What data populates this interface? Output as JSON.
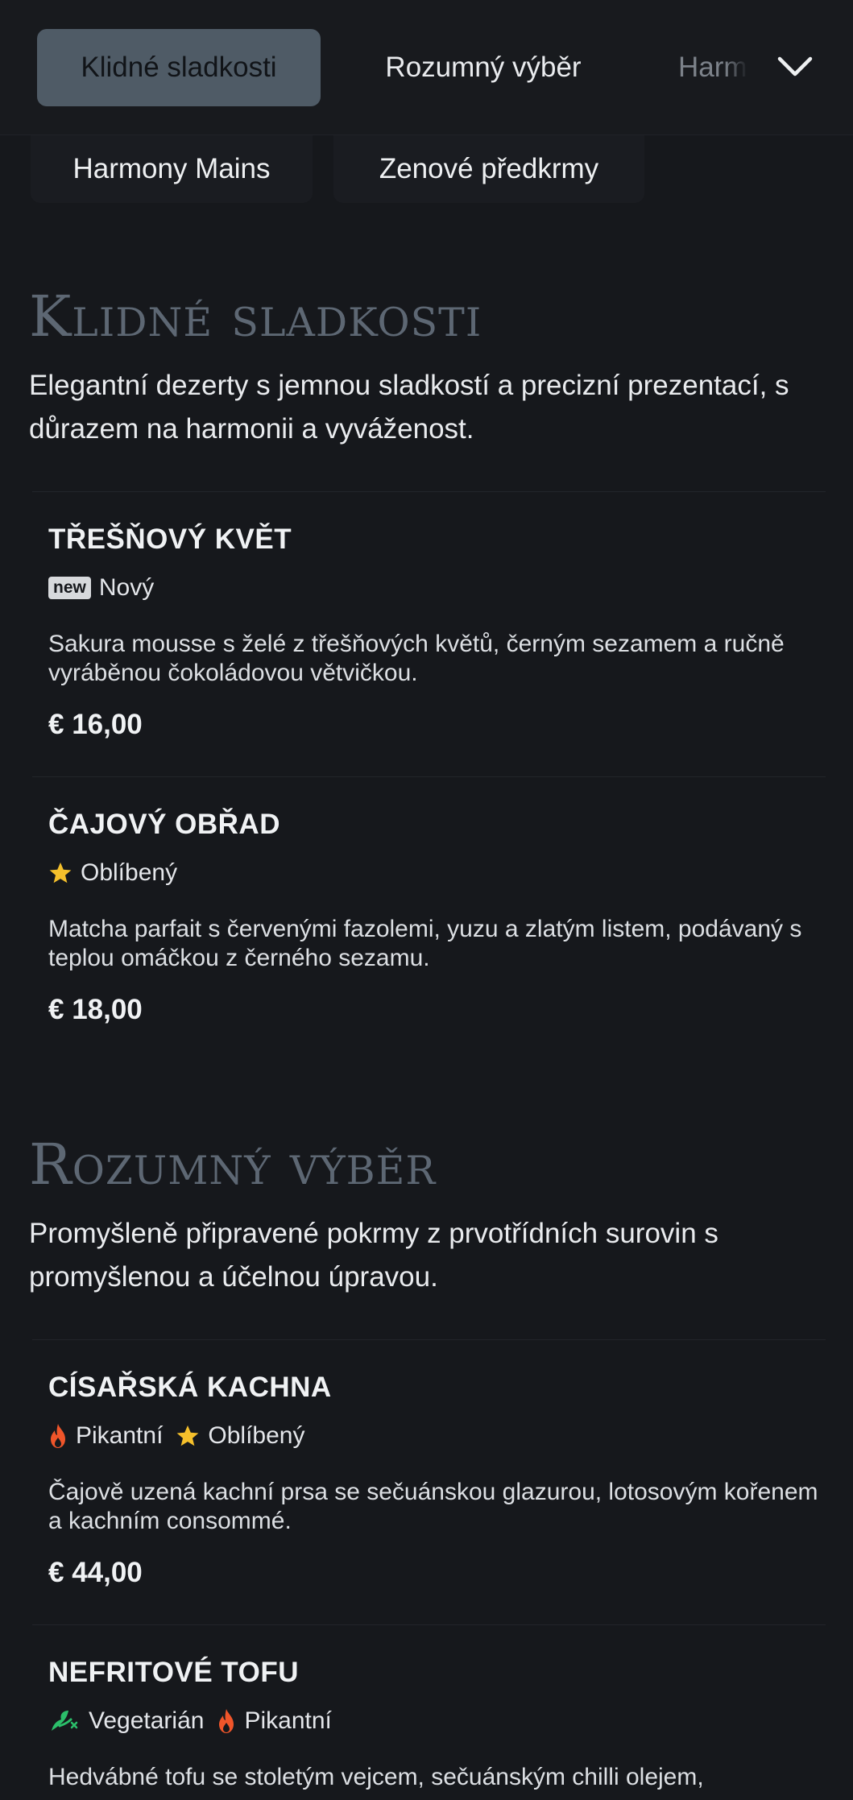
{
  "tabs": [
    "Klidné sladkosti",
    "Rozumný výběr",
    "Harm"
  ],
  "subtabs": [
    "Harmony Mains",
    "Zenové předkrmy"
  ],
  "sections": [
    {
      "title": "Klidné sladkosti",
      "description": "Elegantní dezerty s jemnou sladkostí a precizní prezentací, s důrazem na harmonii a vyváženost.",
      "items": [
        {
          "name": "TŘEŠŇOVÝ KVĚT",
          "tags": [
            {
              "icon": "new-badge",
              "badge": "new",
              "label": "Nový"
            }
          ],
          "description": "Sakura mousse s želé z třešňových květů, černým sezamem a ručně vyráběnou čokoládovou větvičkou.",
          "price": "€ 16,00"
        },
        {
          "name": "ČAJOVÝ OBŘAD",
          "tags": [
            {
              "icon": "star-icon",
              "label": "Oblíbený"
            }
          ],
          "description": "Matcha parfait s červenými fazolemi, yuzu a zlatým listem, podávaný s teplou omáčkou z černého sezamu.",
          "price": "€ 18,00"
        }
      ]
    },
    {
      "title": "Rozumný výběr",
      "description": "Promyšleně připravené pokrmy z prvotřídních surovin s promyšlenou a účelnou úpravou.",
      "items": [
        {
          "name": "CÍSAŘSKÁ KACHNA",
          "tags": [
            {
              "icon": "flame-icon",
              "label": "Pikantní"
            },
            {
              "icon": "star-icon",
              "label": "Oblíbený"
            }
          ],
          "description": "Čajově uzená kachní prsa se sečuánskou glazurou, lotosovým kořenem a kachním consommé.",
          "price": "€ 44,00"
        },
        {
          "name": "NEFRITOVÉ TOFU",
          "tags": [
            {
              "icon": "leaf-icon",
              "label": "Vegetarián"
            },
            {
              "icon": "flame-icon",
              "label": "Pikantní"
            }
          ],
          "description": "Hedvábné tofu se stoletým vejcem, sečuánským chilli olejem,",
          "price": ""
        }
      ]
    }
  ],
  "colors": {
    "background": "#16181c",
    "active_tab": "#4f5b66",
    "section_title": "#5d6773",
    "star": "#f5c02b",
    "flame": "#f0552a",
    "leaf": "#2bbf6a"
  }
}
